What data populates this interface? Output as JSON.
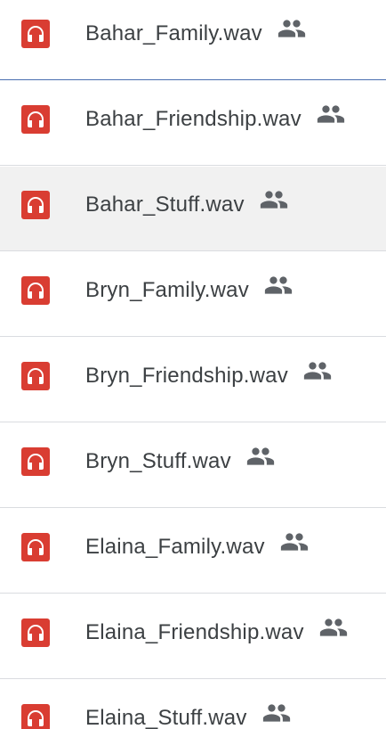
{
  "colors": {
    "audio_icon_bg": "#d93d32",
    "text": "#3c4043",
    "shared_icon": "#5f6368",
    "hover_row": "#f1f1f1",
    "focused_divider": "#4a6fb0"
  },
  "files": [
    {
      "name": "Bahar_Family.wav",
      "type_icon": "headphones-icon",
      "shared": true,
      "shared_icon": "people-icon"
    },
    {
      "name": "Bahar_Friendship.wav",
      "type_icon": "headphones-icon",
      "shared": true,
      "shared_icon": "people-icon"
    },
    {
      "name": "Bahar_Stuff.wav",
      "type_icon": "headphones-icon",
      "shared": true,
      "shared_icon": "people-icon"
    },
    {
      "name": "Bryn_Family.wav",
      "type_icon": "headphones-icon",
      "shared": true,
      "shared_icon": "people-icon"
    },
    {
      "name": "Bryn_Friendship.wav",
      "type_icon": "headphones-icon",
      "shared": true,
      "shared_icon": "people-icon"
    },
    {
      "name": "Bryn_Stuff.wav",
      "type_icon": "headphones-icon",
      "shared": true,
      "shared_icon": "people-icon"
    },
    {
      "name": "Elaina_Family.wav",
      "type_icon": "headphones-icon",
      "shared": true,
      "shared_icon": "people-icon"
    },
    {
      "name": "Elaina_Friendship.wav",
      "type_icon": "headphones-icon",
      "shared": true,
      "shared_icon": "people-icon"
    },
    {
      "name": "Elaina_Stuff.wav",
      "type_icon": "headphones-icon",
      "shared": true,
      "shared_icon": "people-icon"
    }
  ]
}
